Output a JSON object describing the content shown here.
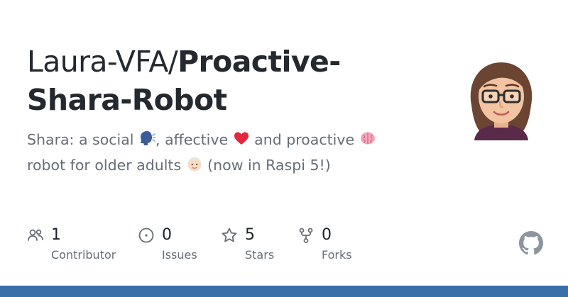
{
  "repo": {
    "owner": "Laura-VFA/",
    "name_line1": "Proactive-",
    "name_line2": "Shara-Robot"
  },
  "description": {
    "part1": "Shara: a social ",
    "emoji_speaking": "🗣",
    "part2": ", affective ",
    "emoji_heart": "❤",
    "part3": " and proactive ",
    "emoji_brain": "🧠",
    "line2_part1": "robot for older adults ",
    "emoji_elder": "👴",
    "line2_part2": " (now in Raspi 5!)"
  },
  "stats": {
    "contributors": {
      "count": "1",
      "label": "Contributor"
    },
    "issues": {
      "count": "0",
      "label": "Issues"
    },
    "stars": {
      "count": "5",
      "label": "Stars"
    },
    "forks": {
      "count": "0",
      "label": "Forks"
    }
  },
  "icons": {
    "contributors": "people-icon",
    "issues": "issue-opened-icon",
    "stars": "star-icon",
    "forks": "repo-forked-icon",
    "brand": "github-mark-icon"
  },
  "colors": {
    "title": "#24292f",
    "text_muted": "#656d76",
    "bottom_bar": "#3b6fa8",
    "heart": "#e5263c",
    "brain": "#f4a7b9"
  }
}
